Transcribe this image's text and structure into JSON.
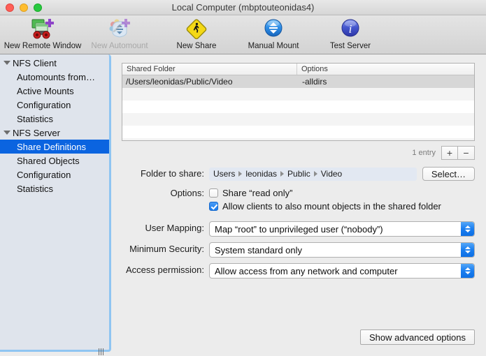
{
  "window": {
    "title": "Local Computer (mbptouteonidas4)",
    "traffic_lights": [
      "close-button",
      "minimize-button",
      "zoom-button"
    ]
  },
  "toolbar": {
    "items": [
      {
        "label": "New Remote Window",
        "icon": "remote-window-icon",
        "enabled": true
      },
      {
        "label": "New Automount",
        "icon": "automount-icon",
        "enabled": false
      },
      {
        "label": "New Share",
        "icon": "new-share-icon",
        "enabled": true
      },
      {
        "label": "Manual Mount",
        "icon": "manual-mount-icon",
        "enabled": true
      },
      {
        "label": "Test Server",
        "icon": "test-server-icon",
        "enabled": true
      }
    ]
  },
  "sidebar": {
    "items": [
      {
        "label": "NFS Client",
        "type": "group",
        "expanded": true,
        "selected": false
      },
      {
        "label": "Automounts from…",
        "type": "child",
        "selected": false
      },
      {
        "label": "Active Mounts",
        "type": "child",
        "selected": false
      },
      {
        "label": "Configuration",
        "type": "child",
        "selected": false
      },
      {
        "label": "Statistics",
        "type": "child",
        "selected": false
      },
      {
        "label": "NFS Server",
        "type": "group",
        "expanded": true,
        "selected": false
      },
      {
        "label": "Share Definitions",
        "type": "child",
        "selected": true
      },
      {
        "label": "Shared Objects",
        "type": "child",
        "selected": false
      },
      {
        "label": "Configuration",
        "type": "child",
        "selected": false
      },
      {
        "label": "Statistics",
        "type": "child",
        "selected": false
      }
    ],
    "selected_color": "#0b64e0"
  },
  "table": {
    "columns": [
      "Shared Folder",
      "Options"
    ],
    "rows": [
      {
        "shared_folder": "/Users/leonidas/Public/Video",
        "options": "-alldirs",
        "selected": true
      }
    ],
    "empty_row_count": 5,
    "entry_count_label": "1 entry",
    "add_button_label": "+",
    "remove_button_label": "−"
  },
  "form": {
    "folder_to_share": {
      "label": "Folder to share:",
      "path_components": [
        "Users",
        "leonidas",
        "Public",
        "Video"
      ],
      "select_button_label": "Select…"
    },
    "options": {
      "label": "Options:",
      "checkboxes": [
        {
          "label": "Share “read only”",
          "checked": false
        },
        {
          "label": "Allow clients to also mount objects in the shared folder",
          "checked": true
        }
      ]
    },
    "user_mapping": {
      "label": "User Mapping:",
      "value": "Map “root” to unprivileged user (“nobody”)"
    },
    "minimum_security": {
      "label": "Minimum Security:",
      "value": "System standard only"
    },
    "access_permission": {
      "label": "Access permission:",
      "value": "Allow access from any network and computer"
    }
  },
  "footer": {
    "advanced_button_label": "Show advanced options"
  },
  "colors": {
    "accent_blue": "#0b64e0",
    "checkbox_blue": "#1a7ced",
    "stepper_blue": "#1a7ef0",
    "sidebar_bg": "#dfe4ec",
    "focus_ring": "#8fc5f2",
    "window_bg": "#ececec"
  }
}
